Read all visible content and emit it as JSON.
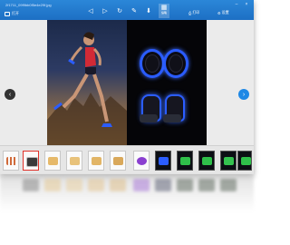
{
  "window": {
    "title": "2f1711_09f9bb0f5e4e29f.jpg",
    "open_label": "打开",
    "active_tool_label": "缩略",
    "print_label": "打印",
    "settings_label": "设置"
  },
  "toolbar": {
    "icons": [
      "prev-page-icon",
      "next-page-icon",
      "rotate-icon",
      "edit-icon",
      "save-icon",
      "thumbnail-icon"
    ]
  },
  "colors": {
    "titlebar": "#1d6fc4",
    "accent": "#1e88e5",
    "selected_thumb": "#e0322a",
    "glow": "#2b5dff"
  },
  "strip": {
    "thumbnails": [
      {
        "kind": "dots",
        "selected": false
      },
      {
        "kind": "cards",
        "selected": true
      },
      {
        "kind": "bulbs",
        "selected": false
      },
      {
        "kind": "bulbs",
        "selected": false
      },
      {
        "kind": "bulbs",
        "selected": false
      },
      {
        "kind": "bulbs",
        "selected": false
      },
      {
        "kind": "purple-band",
        "selected": false
      },
      {
        "kind": "blue-band",
        "selected": false
      },
      {
        "kind": "green-device",
        "selected": false
      },
      {
        "kind": "green-device",
        "selected": false
      },
      {
        "kind": "green-device",
        "selected": false
      },
      {
        "kind": "green-device",
        "selected": false
      }
    ]
  }
}
